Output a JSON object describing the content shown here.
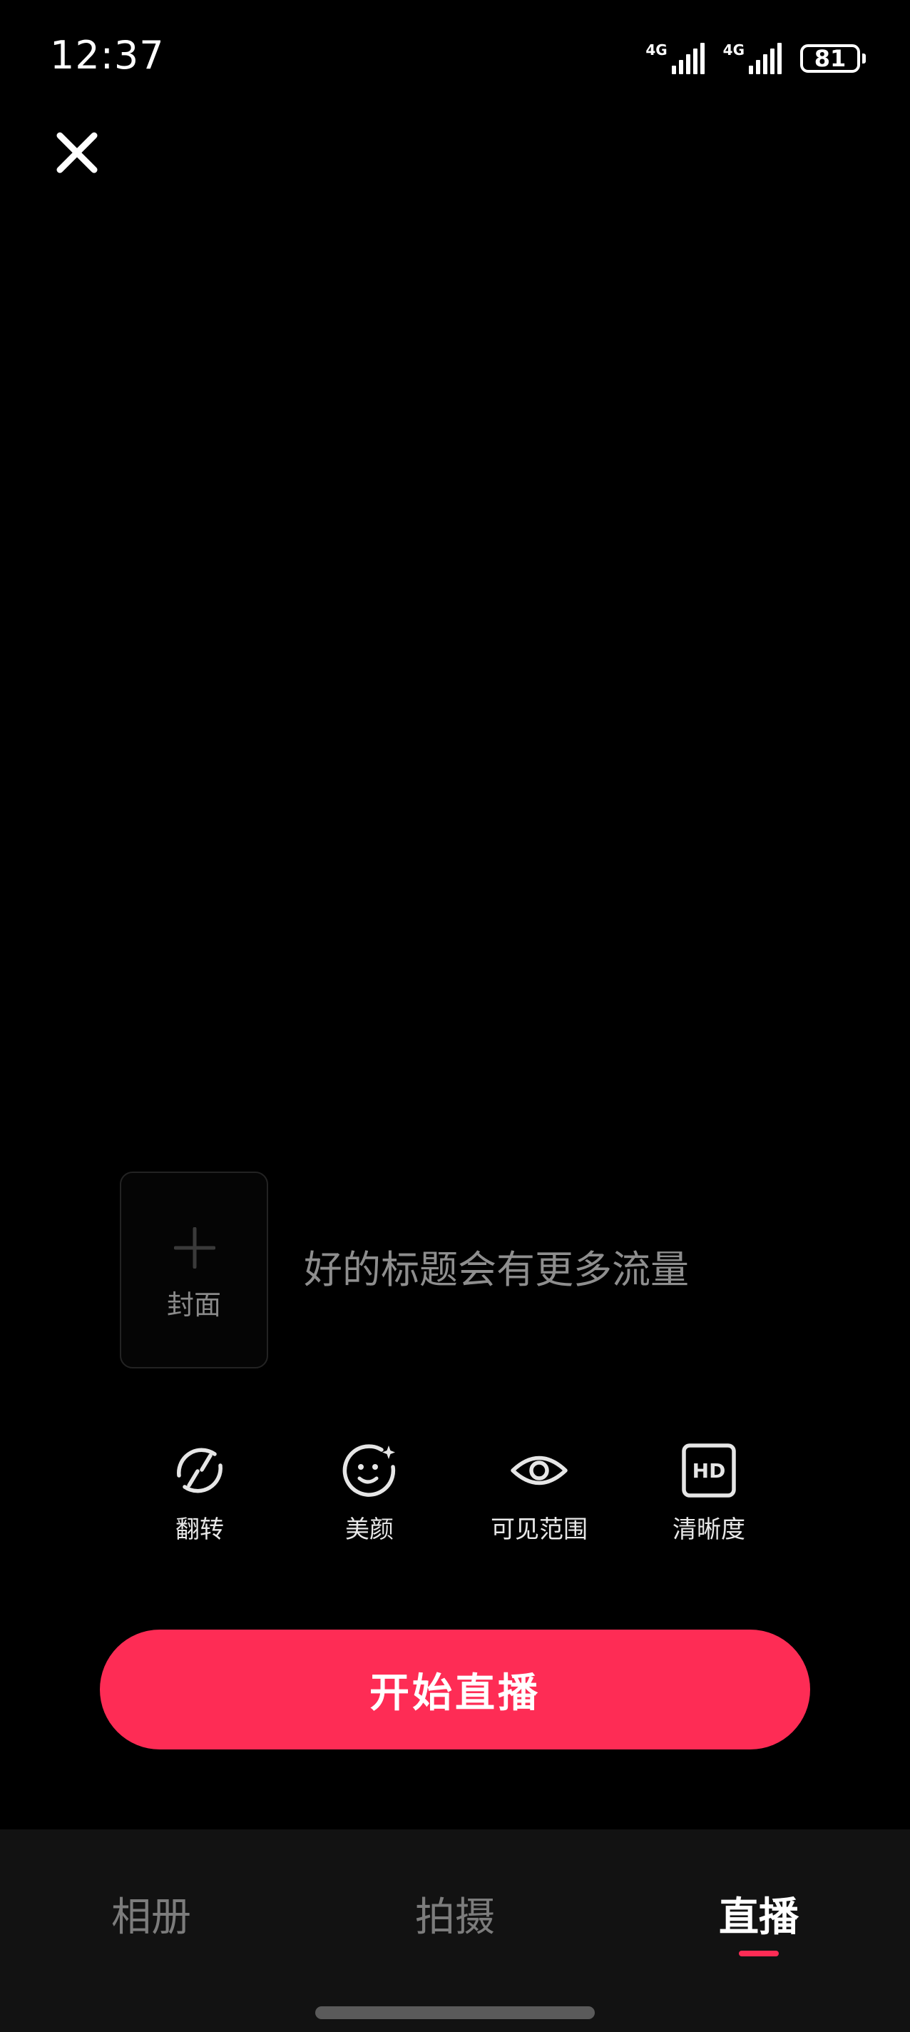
{
  "status_bar": {
    "time": "12:37",
    "signal_1_label": "4G",
    "signal_2_label": "4G",
    "battery_level": "81"
  },
  "cover": {
    "label": "封面"
  },
  "title_input": {
    "placeholder": "好的标题会有更多流量"
  },
  "tools": [
    {
      "label": "翻转",
      "icon": "flip-camera-icon"
    },
    {
      "label": "美颜",
      "icon": "beauty-face-icon"
    },
    {
      "label": "可见范围",
      "icon": "eye-icon"
    },
    {
      "label": "清晰度",
      "icon": "hd-icon"
    }
  ],
  "hd_badge": "HD",
  "start_button": {
    "label": "开始直播",
    "color": "#fe2c55"
  },
  "bottom_nav": {
    "items": [
      {
        "label": "相册"
      },
      {
        "label": "拍摄"
      },
      {
        "label": "直播"
      }
    ],
    "active_index": 2
  }
}
